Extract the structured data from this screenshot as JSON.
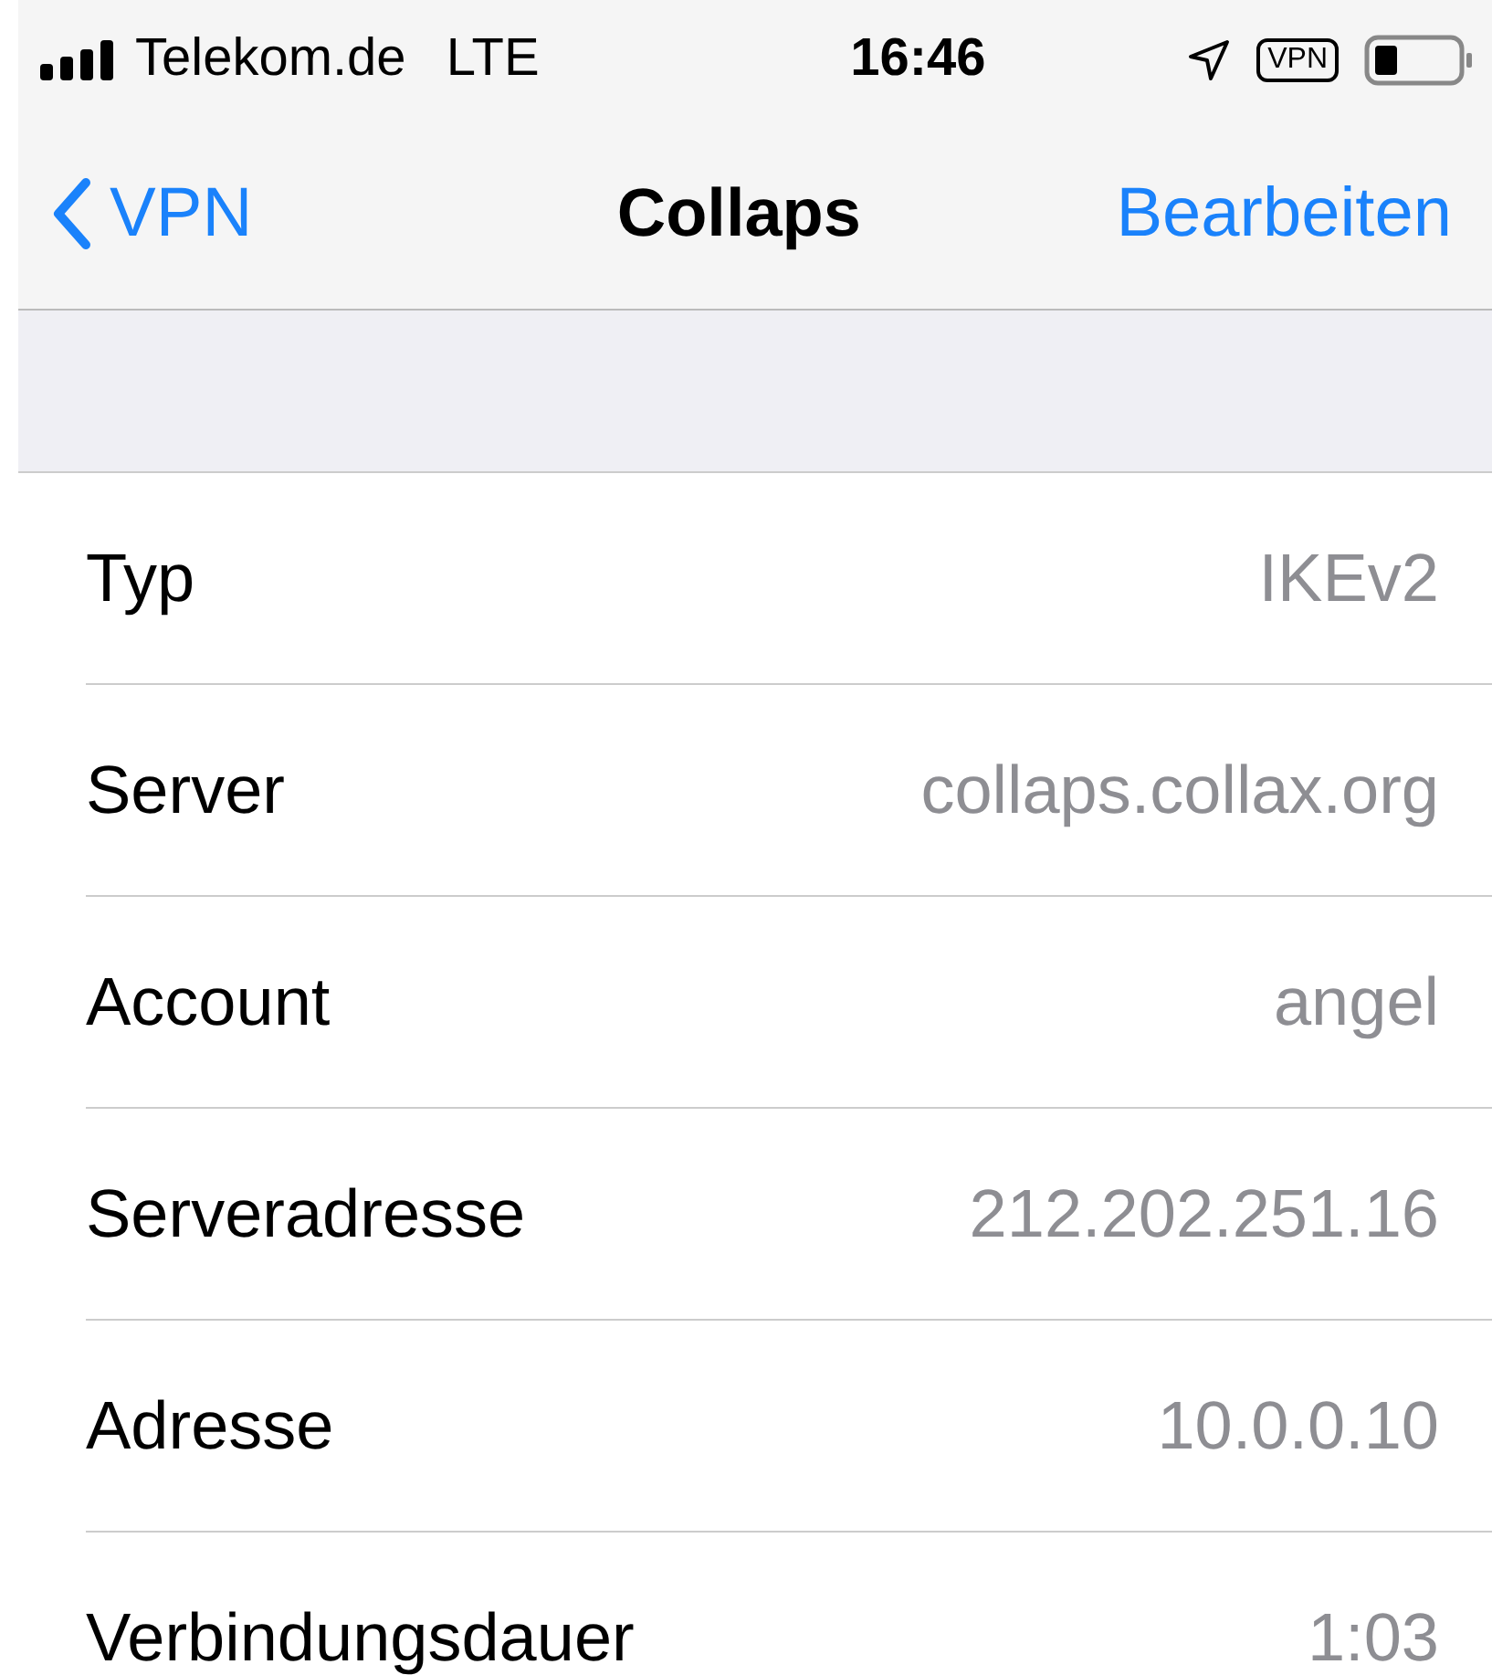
{
  "status_bar": {
    "carrier": "Telekom.de",
    "network": "LTE",
    "time": "16:46",
    "vpn_badge": "VPN"
  },
  "nav_bar": {
    "back_label": "VPN",
    "title": "Collaps",
    "action": "Bearbeiten"
  },
  "rows": [
    {
      "label": "Typ",
      "value": "IKEv2"
    },
    {
      "label": "Server",
      "value": "collaps.collax.org"
    },
    {
      "label": "Account",
      "value": "angel"
    },
    {
      "label": "Serveradresse",
      "value": "212.202.251.16"
    },
    {
      "label": "Adresse",
      "value": "10.0.0.10"
    },
    {
      "label": "Verbindungsdauer",
      "value": "1:03"
    }
  ]
}
